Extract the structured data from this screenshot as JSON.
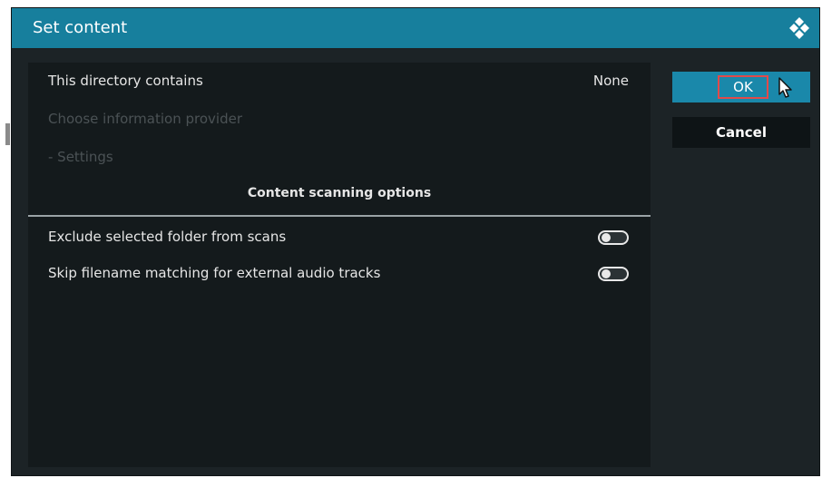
{
  "dialog": {
    "title": "Set content",
    "logo_icon": "kodi-logo-icon"
  },
  "rows": [
    {
      "label": "This directory contains",
      "value": "None",
      "enabled": true
    },
    {
      "label": "Choose information provider",
      "value": "",
      "enabled": false
    },
    {
      "label": "- Settings",
      "value": "",
      "enabled": false
    }
  ],
  "section": {
    "header": "Content scanning options"
  },
  "toggles": [
    {
      "label": "Exclude selected folder from scans",
      "state": false,
      "icon": "toggle-off-icon"
    },
    {
      "label": "Skip filename matching for external audio tracks",
      "state": false,
      "icon": "toggle-off-icon"
    }
  ],
  "buttons": {
    "ok_label": "OK",
    "cancel_label": "Cancel"
  },
  "colors": {
    "title_bar": "#177f9d",
    "ok_button": "#1a88aa",
    "highlight_border": "#e24a4a",
    "panel_bg": "#141a1c"
  },
  "cursor_icon": "mouse-pointer-icon"
}
